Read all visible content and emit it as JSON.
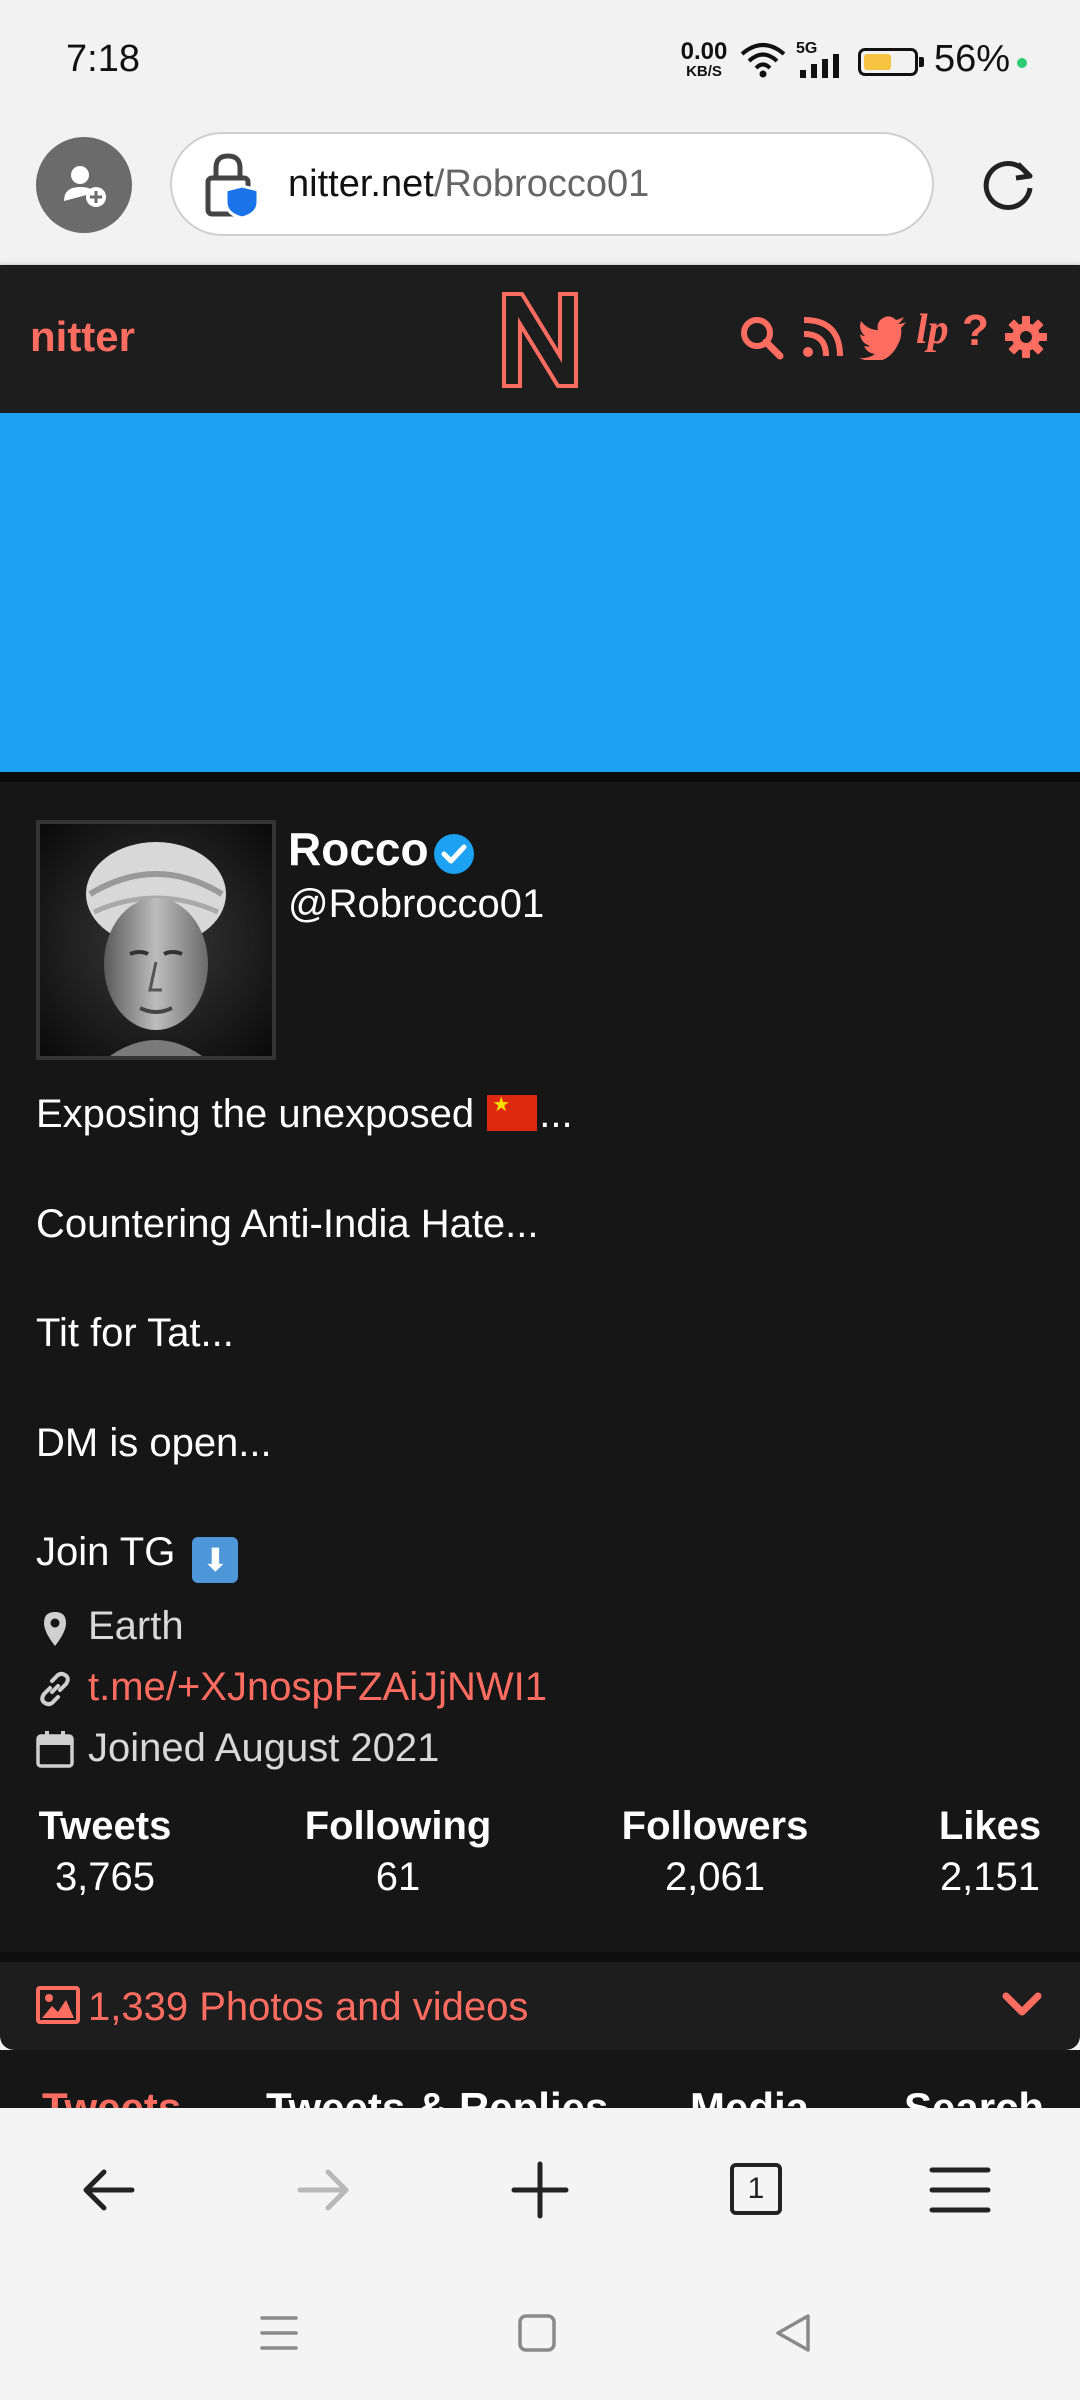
{
  "status_bar": {
    "time": "7:18",
    "net_speed_value": "0.00",
    "net_speed_unit": "KB/S",
    "signal_label": "5G",
    "battery_percent": "56%",
    "battery_level": 0.56
  },
  "browser": {
    "url_domain": "nitter.net",
    "url_path": "/Robrocco01",
    "tab_count": "1"
  },
  "nav": {
    "brand": "nitter",
    "icons": [
      "search-icon",
      "rss-icon",
      "twitter-icon",
      "lp-icon",
      "help-icon",
      "settings-icon"
    ],
    "accent": "#ff6c60"
  },
  "banner": {
    "color": "#1da1f2"
  },
  "profile": {
    "fullname": "Rocco",
    "username": "@Robrocco01",
    "bio_1_text": "Exposing the unexposed ",
    "bio_1_tail": "...",
    "bio_2": "Countering Anti-India Hate...",
    "bio_3": "Tit for Tat...",
    "bio_4": "DM is open...",
    "bio_5": "Join TG ",
    "location": "Earth",
    "website": "t.me/+XJnospFZAiJjNWI1",
    "joined": "Joined August 2021"
  },
  "stats": [
    {
      "label": "Tweets",
      "value": "3,765"
    },
    {
      "label": "Following",
      "value": "61"
    },
    {
      "label": "Followers",
      "value": "2,061"
    },
    {
      "label": "Likes",
      "value": "2,151"
    }
  ],
  "media": {
    "label": "1,339 Photos and videos"
  },
  "tabs": [
    "Tweets",
    "Tweets & Replies",
    "Media",
    "Search"
  ]
}
